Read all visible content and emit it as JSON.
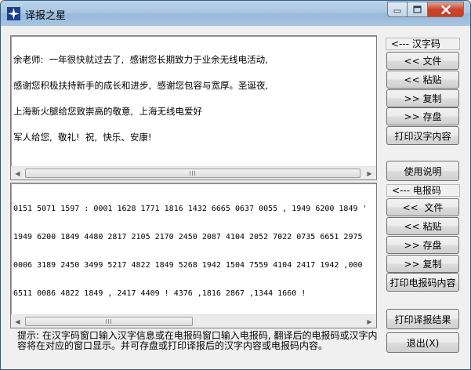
{
  "window": {
    "title": "译报之星"
  },
  "upper_text": {
    "lines": [
      "余老师:  一年很快就过去了,  感谢您长期致力于业余无线电活动,",
      "感谢您积极扶持新手的成长和进步,  感谢您包容与宽厚。圣诞夜,",
      "上海新火腿给您致崇高的敬意,  上海无线电爱好",
      "军人给您,  敬礼!  祝,  快乐、安康!"
    ]
  },
  "lower_text": {
    "lines": [
      "0151 5071 1597 : 0001 1628 1771 1816 1432 6665 0637 0055 , 1949 6200 1849 '",
      "1949 6200 1849 4480 2817 2105 2170 2450 2087 4104 2052 7022 0735 6651 2975",
      "0006 3189 2450 3499 5217 4822 1849 5268 1942 1504 7559 4104 2417 1942 ,000",
      "6511 0086 4822 1849 , 2417 4409 ! 4376 ,1816 2867 ,1344 1660 !"
    ]
  },
  "hanzi_panel": {
    "label": "<--- 汉字码",
    "buttons": [
      "<< 文件",
      "<< 粘贴",
      ">> 复制",
      ">> 存盘",
      "打印汉字内容"
    ]
  },
  "help_button": "使用说明",
  "telegraph_panel": {
    "label": "<--- 电报码",
    "buttons": [
      "<<  文件",
      "<< 粘贴",
      ">> 存盘",
      ">> 复制",
      "打印电报码内容"
    ]
  },
  "print_result_button": "打印译报结果",
  "exit_button": "退出(X)",
  "hint": "提示: 在汉字码窗口输入汉字信息或在电报码窗口输入电报码, 翻译后的电报码或汉字内容将在对应的窗口显示。并可存盘或打印译报后的汉字内容或电报码内容。"
}
